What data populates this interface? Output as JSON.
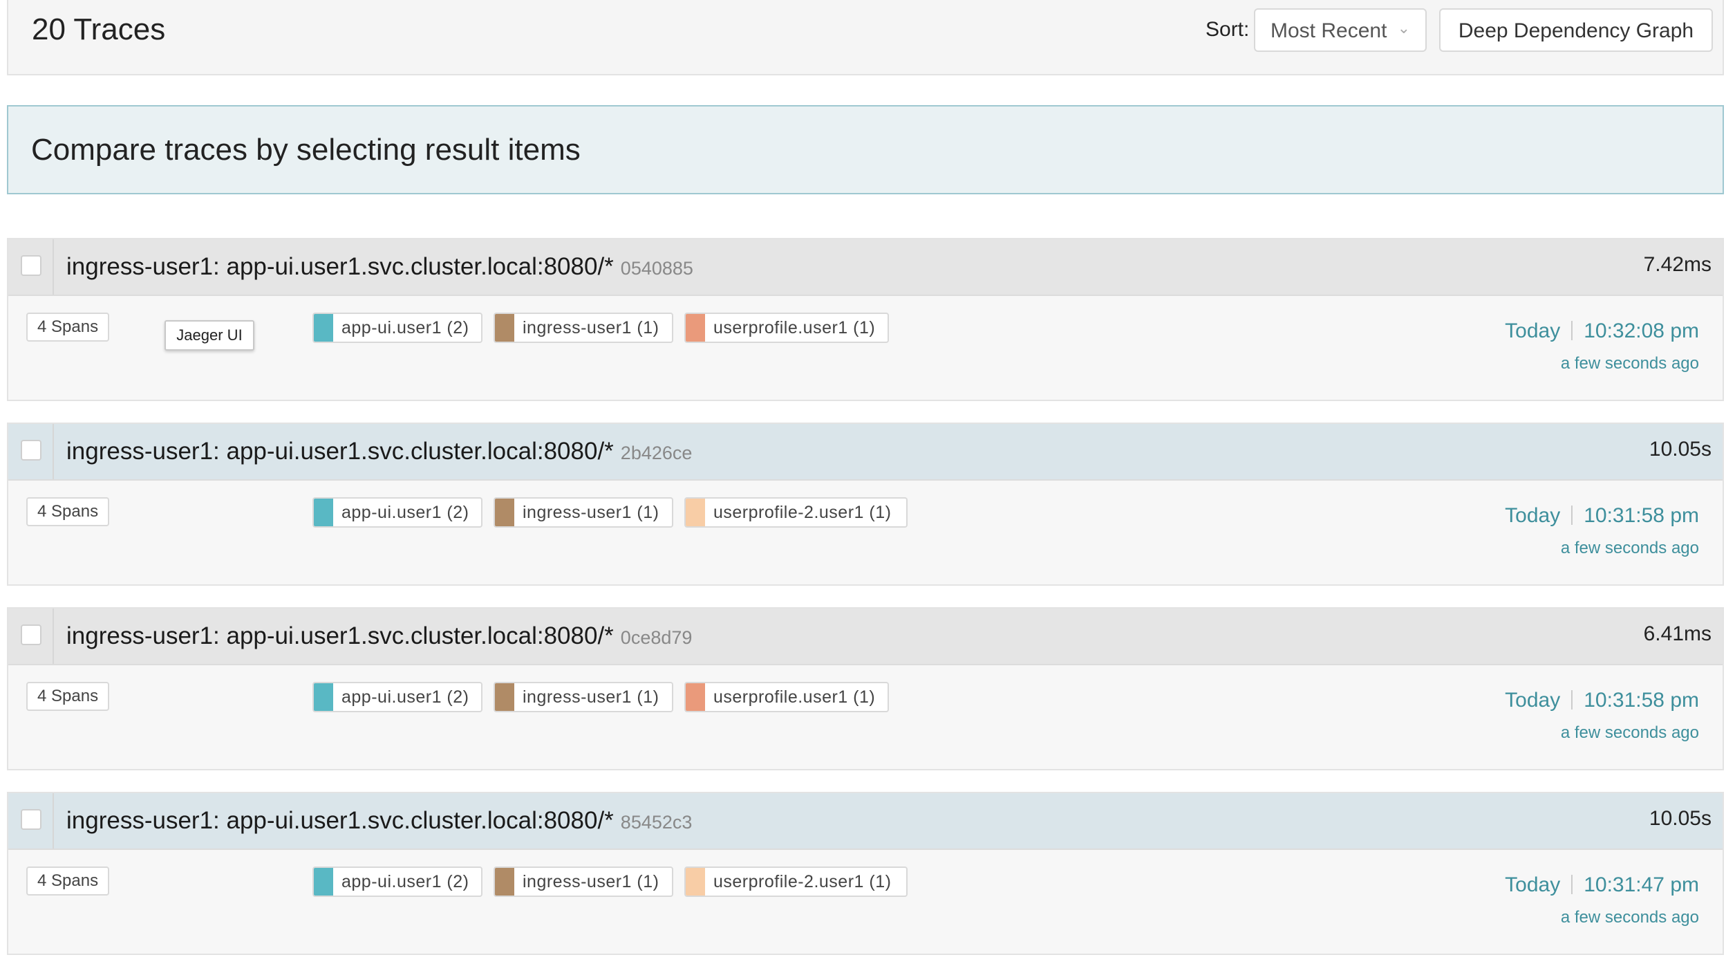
{
  "header": {
    "title": "20 Traces",
    "sort_label": "Sort:",
    "sort_value": "Most Recent",
    "ddg_button": "Deep Dependency Graph"
  },
  "compare_banner": "Compare traces by selecting result items",
  "tooltip": "Jaeger UI",
  "colors": {
    "app_ui": "#59b8c4",
    "ingress": "#b08b66",
    "userprofile": "#ea9a7b",
    "userprofile2": "#f8cda6",
    "time_text": "#3e8f9c"
  },
  "traces": [
    {
      "title": "ingress-user1: app-ui.user1.svc.cluster.local:8080/*",
      "id": "0540885",
      "duration": "7.42ms",
      "spans": "4 Spans",
      "services": [
        {
          "label": "app-ui.user1 (2)",
          "color": "#59b8c4"
        },
        {
          "label": "ingress-user1 (1)",
          "color": "#b08b66"
        },
        {
          "label": "userprofile.user1 (1)",
          "color": "#ea9a7b"
        }
      ],
      "day": "Today",
      "time": "10:32:08 pm",
      "ago": "a few seconds ago"
    },
    {
      "title": "ingress-user1: app-ui.user1.svc.cluster.local:8080/*",
      "id": "2b426ce",
      "duration": "10.05s",
      "spans": "4 Spans",
      "services": [
        {
          "label": "app-ui.user1 (2)",
          "color": "#59b8c4"
        },
        {
          "label": "ingress-user1 (1)",
          "color": "#b08b66"
        },
        {
          "label": "userprofile-2.user1 (1)",
          "color": "#f8cda6"
        }
      ],
      "day": "Today",
      "time": "10:31:58 pm",
      "ago": "a few seconds ago"
    },
    {
      "title": "ingress-user1: app-ui.user1.svc.cluster.local:8080/*",
      "id": "0ce8d79",
      "duration": "6.41ms",
      "spans": "4 Spans",
      "services": [
        {
          "label": "app-ui.user1 (2)",
          "color": "#59b8c4"
        },
        {
          "label": "ingress-user1 (1)",
          "color": "#b08b66"
        },
        {
          "label": "userprofile.user1 (1)",
          "color": "#ea9a7b"
        }
      ],
      "day": "Today",
      "time": "10:31:58 pm",
      "ago": "a few seconds ago"
    },
    {
      "title": "ingress-user1: app-ui.user1.svc.cluster.local:8080/*",
      "id": "85452c3",
      "duration": "10.05s",
      "spans": "4 Spans",
      "services": [
        {
          "label": "app-ui.user1 (2)",
          "color": "#59b8c4"
        },
        {
          "label": "ingress-user1 (1)",
          "color": "#b08b66"
        },
        {
          "label": "userprofile-2.user1 (1)",
          "color": "#f8cda6"
        }
      ],
      "day": "Today",
      "time": "10:31:47 pm",
      "ago": "a few seconds ago"
    }
  ]
}
